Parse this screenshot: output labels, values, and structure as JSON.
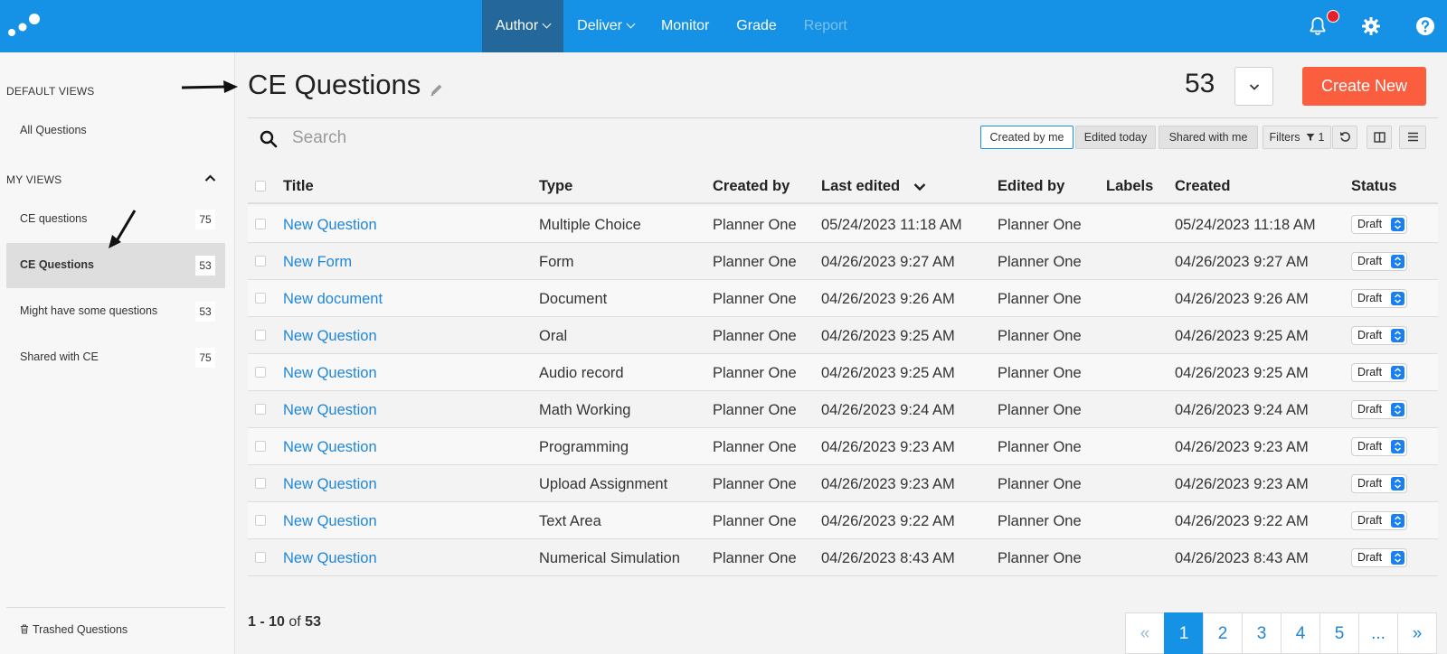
{
  "nav": {
    "items": [
      {
        "label": "Author",
        "has_caret": true,
        "active": true,
        "disabled": false
      },
      {
        "label": "Deliver",
        "has_caret": true,
        "active": false,
        "disabled": false
      },
      {
        "label": "Monitor",
        "has_caret": false,
        "active": false,
        "disabled": false
      },
      {
        "label": "Grade",
        "has_caret": false,
        "active": false,
        "disabled": false
      },
      {
        "label": "Report",
        "has_caret": false,
        "active": false,
        "disabled": true
      }
    ],
    "icons": [
      "bell-icon",
      "gear-icon",
      "help-icon"
    ],
    "notification": true
  },
  "sidebar": {
    "default_heading": "DEFAULT VIEWS",
    "default_items": [
      {
        "label": "All Questions"
      }
    ],
    "my_heading": "MY VIEWS",
    "my_items": [
      {
        "label": "CE questions",
        "count": "75",
        "selected": false
      },
      {
        "label": "CE Questions",
        "count": "53",
        "selected": true
      },
      {
        "label": "Might have some questions",
        "count": "53",
        "selected": false
      },
      {
        "label": "Shared with CE",
        "count": "75",
        "selected": false
      }
    ],
    "trash_label": "Trashed Questions"
  },
  "header": {
    "title": "CE Questions",
    "total": "53",
    "create_label": "Create New"
  },
  "toolbar": {
    "search_placeholder": "Search",
    "chips": [
      {
        "label": "Created by me",
        "selected": true
      },
      {
        "label": "Edited today",
        "selected": false
      },
      {
        "label": "Shared with me",
        "selected": false
      }
    ],
    "filters_label": "Filters",
    "filters_count": "1"
  },
  "table": {
    "columns": [
      "Title",
      "Type",
      "Created by",
      "Last edited",
      "Edited by",
      "Labels",
      "Created",
      "Status"
    ],
    "sort_column": "Last edited",
    "rows": [
      {
        "title": "New Question",
        "type": "Multiple Choice",
        "created_by": "Planner One",
        "last_edited": "05/24/2023 11:18 AM",
        "edited_by": "Planner One",
        "labels": "",
        "created": "05/24/2023 11:18 AM",
        "status": "Draft"
      },
      {
        "title": "New Form",
        "type": "Form",
        "created_by": "Planner One",
        "last_edited": "04/26/2023 9:27 AM",
        "edited_by": "Planner One",
        "labels": "",
        "created": "04/26/2023 9:27 AM",
        "status": "Draft"
      },
      {
        "title": "New document",
        "type": "Document",
        "created_by": "Planner One",
        "last_edited": "04/26/2023 9:26 AM",
        "edited_by": "Planner One",
        "labels": "",
        "created": "04/26/2023 9:26 AM",
        "status": "Draft"
      },
      {
        "title": "New Question",
        "type": "Oral",
        "created_by": "Planner One",
        "last_edited": "04/26/2023 9:25 AM",
        "edited_by": "Planner One",
        "labels": "",
        "created": "04/26/2023 9:25 AM",
        "status": "Draft"
      },
      {
        "title": "New Question",
        "type": "Audio record",
        "created_by": "Planner One",
        "last_edited": "04/26/2023 9:25 AM",
        "edited_by": "Planner One",
        "labels": "",
        "created": "04/26/2023 9:25 AM",
        "status": "Draft"
      },
      {
        "title": "New Question",
        "type": "Math Working",
        "created_by": "Planner One",
        "last_edited": "04/26/2023 9:24 AM",
        "edited_by": "Planner One",
        "labels": "",
        "created": "04/26/2023 9:24 AM",
        "status": "Draft"
      },
      {
        "title": "New Question",
        "type": "Programming",
        "created_by": "Planner One",
        "last_edited": "04/26/2023 9:23 AM",
        "edited_by": "Planner One",
        "labels": "",
        "created": "04/26/2023 9:23 AM",
        "status": "Draft"
      },
      {
        "title": "New Question",
        "type": "Upload Assignment",
        "created_by": "Planner One",
        "last_edited": "04/26/2023 9:23 AM",
        "edited_by": "Planner One",
        "labels": "",
        "created": "04/26/2023 9:23 AM",
        "status": "Draft"
      },
      {
        "title": "New Question",
        "type": "Text Area",
        "created_by": "Planner One",
        "last_edited": "04/26/2023 9:22 AM",
        "edited_by": "Planner One",
        "labels": "",
        "created": "04/26/2023 9:22 AM",
        "status": "Draft"
      },
      {
        "title": "New Question",
        "type": "Numerical Simulation",
        "created_by": "Planner One",
        "last_edited": "04/26/2023 8:43 AM",
        "edited_by": "Planner One",
        "labels": "",
        "created": "04/26/2023 8:43 AM",
        "status": "Draft"
      }
    ]
  },
  "footer": {
    "range_start": "1",
    "range_end": "10",
    "range_of": "of",
    "range_total": "53",
    "pages": [
      "«",
      "1",
      "2",
      "3",
      "4",
      "5",
      "...",
      "»"
    ],
    "current_page": "1"
  },
  "colors": {
    "topbar": "#1592e6",
    "nav_active": "#24679b",
    "create_button": "#fb5d3f",
    "link": "#1f86d8"
  }
}
